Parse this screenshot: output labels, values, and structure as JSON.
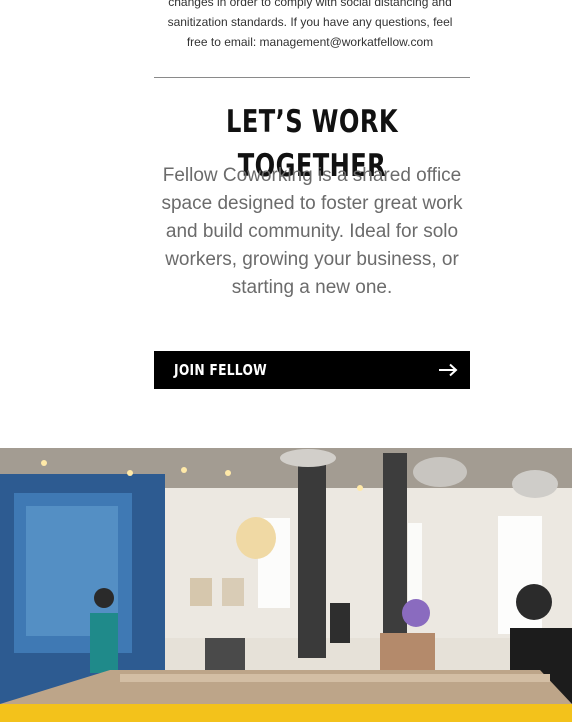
{
  "notice": {
    "line1": "changes in order to comply with social distancing and",
    "line2": "sanitization standards. If you have any questions, feel",
    "line3": "free to email: management@workatfellow.com"
  },
  "section": {
    "heading": "LET’S WORK TOGETHER",
    "intro": "Fellow Coworking is a shared office space designed to foster great work and build community. Ideal for solo workers, growing your business, or starting a new one."
  },
  "cta": {
    "label": "JOIN FELLOW",
    "icon": "arrow-right-icon"
  },
  "colors": {
    "accent_yellow": "#f3c21b",
    "button_bg": "#000000",
    "button_text": "#ffffff",
    "body_text": "#6b6b6b",
    "heading_text": "#111111"
  }
}
